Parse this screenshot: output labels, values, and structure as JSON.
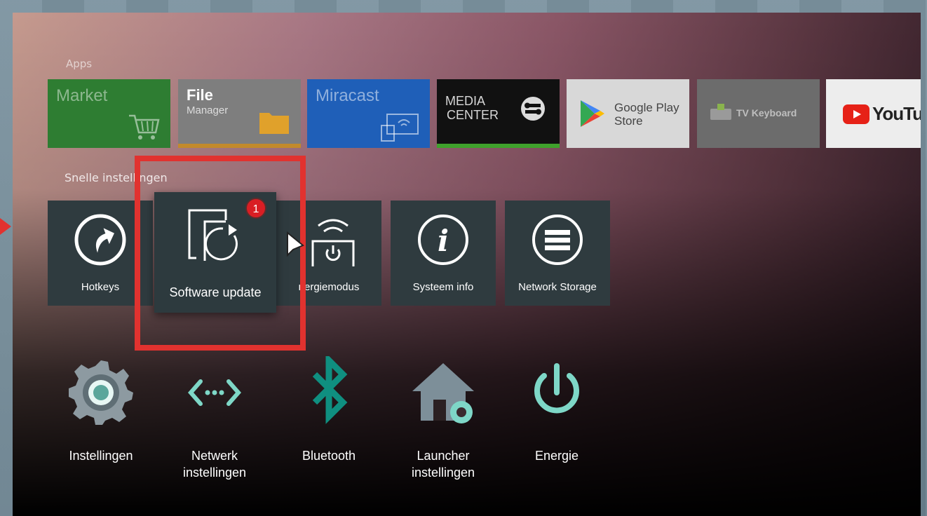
{
  "apps_section": {
    "label": "Apps"
  },
  "apps": [
    {
      "title": "Market"
    },
    {
      "title": "File",
      "subtitle": "Manager"
    },
    {
      "title": "Miracast"
    },
    {
      "title": "MEDIA",
      "subtitle": "CENTER"
    },
    {
      "title": "Google Play",
      "subtitle": "Store"
    },
    {
      "title": "TV Keyboard"
    },
    {
      "title": "YouTub"
    }
  ],
  "quick_section": {
    "label": "Snelle instellingen"
  },
  "quick_tiles": [
    {
      "label": "Hotkeys"
    },
    {
      "label": "Software update",
      "badge": "1"
    },
    {
      "label": "nergiemodus"
    },
    {
      "label": "Systeem info"
    },
    {
      "label": "Network Storage"
    }
  ],
  "settings": [
    {
      "label": "Instellingen"
    },
    {
      "label": "Netwerk\ninstellingen"
    },
    {
      "label": "Bluetooth"
    },
    {
      "label": "Launcher\ninstellingen"
    },
    {
      "label": "Energie"
    }
  ],
  "colors": {
    "highlight": "#e1322f",
    "accent_teal": "#7ed7c7",
    "bluetooth": "#0f8f80",
    "badge": "#d91e24"
  }
}
